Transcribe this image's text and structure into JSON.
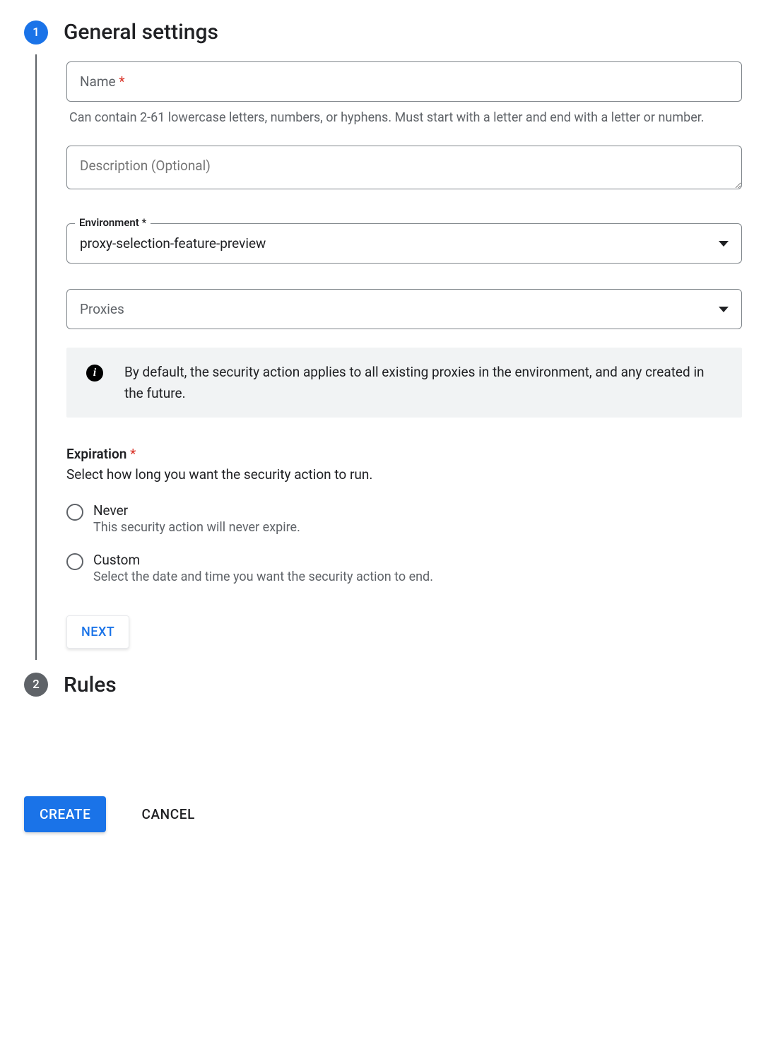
{
  "steps": {
    "one": {
      "number": "1",
      "title": "General settings"
    },
    "two": {
      "number": "2",
      "title": "Rules"
    }
  },
  "name_field": {
    "label": "Name",
    "required_mark": "*",
    "helper": "Can contain 2-61 lowercase letters, numbers, or hyphens. Must start with a letter and end with a letter or number."
  },
  "description_field": {
    "placeholder": "Description (Optional)"
  },
  "environment_field": {
    "label": "Environment *",
    "value": "proxy-selection-feature-preview"
  },
  "proxies_field": {
    "placeholder": "Proxies"
  },
  "info_panel": {
    "text": "By default, the security action applies to all existing proxies in the environment, and any created in the future."
  },
  "expiration": {
    "title": "Expiration",
    "required_mark": "*",
    "subtitle": "Select how long you want the security action to run.",
    "options": [
      {
        "label": "Never",
        "description": "This security action will never expire."
      },
      {
        "label": "Custom",
        "description": "Select the date and time you want the security action to end."
      }
    ]
  },
  "buttons": {
    "next": "NEXT",
    "create": "CREATE",
    "cancel": "CANCEL"
  }
}
